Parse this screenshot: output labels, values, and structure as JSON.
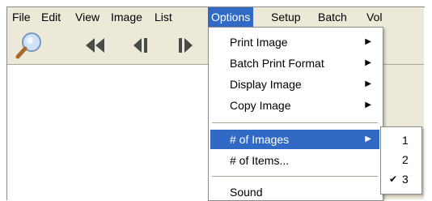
{
  "menubar": {
    "items": [
      "File",
      "Edit",
      "View",
      "Image",
      "List",
      "Options",
      "Setup",
      "Batch",
      "Vol"
    ],
    "active": "Options"
  },
  "toolbar": {
    "tools": [
      "search-icon",
      "first-icon",
      "previous-icon",
      "next-icon"
    ]
  },
  "options_menu": {
    "items": [
      {
        "label": "Print Image",
        "submenu": true
      },
      {
        "label": "Batch Print Format",
        "submenu": true
      },
      {
        "label": "Display Image",
        "submenu": true
      },
      {
        "label": "Copy Image",
        "submenu": true
      },
      {
        "label": "# of Images",
        "submenu": true,
        "highlighted": true
      },
      {
        "label": "# of Items...",
        "submenu": false
      },
      {
        "label": "Sound",
        "submenu": false
      }
    ]
  },
  "images_submenu": {
    "items": [
      {
        "label": "1",
        "checked": false
      },
      {
        "label": "2",
        "checked": false
      },
      {
        "label": "3",
        "checked": true
      }
    ]
  },
  "colors": {
    "menu_background": "#ece9d8",
    "highlight": "#316ac5"
  }
}
